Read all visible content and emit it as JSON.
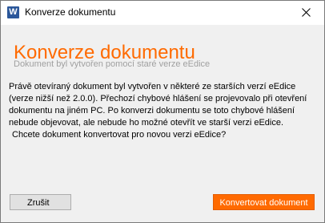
{
  "window": {
    "title": "Konverze dokumentu",
    "app_icon_letter": "W"
  },
  "dialog": {
    "heading": "Konverze dokumentu",
    "subheading": "Dokument byl vytvořen pomocí staré verze eEdice",
    "message": "Právě otevíraný dokument byl vytvořen v některé ze starších verzí eEdice (verze nižší než 2.0.0). Přechozí chybové hlášení se projevovalo při otevření dokumentu na jiném PC. Po konverzi dokumentu se toto chybové hlášení nebude objevovat, ale nebude ho možné otevřít ve starší verzi eEdice.",
    "question": "Chcete dokument konvertovat pro novou verzi eEdice?"
  },
  "buttons": {
    "cancel_label": "Zrušit",
    "convert_label": "Konvertovat dokument"
  },
  "colors": {
    "accent": "#ff6a00",
    "subheading": "#a0a0a0",
    "background": "#f0f0f0"
  }
}
